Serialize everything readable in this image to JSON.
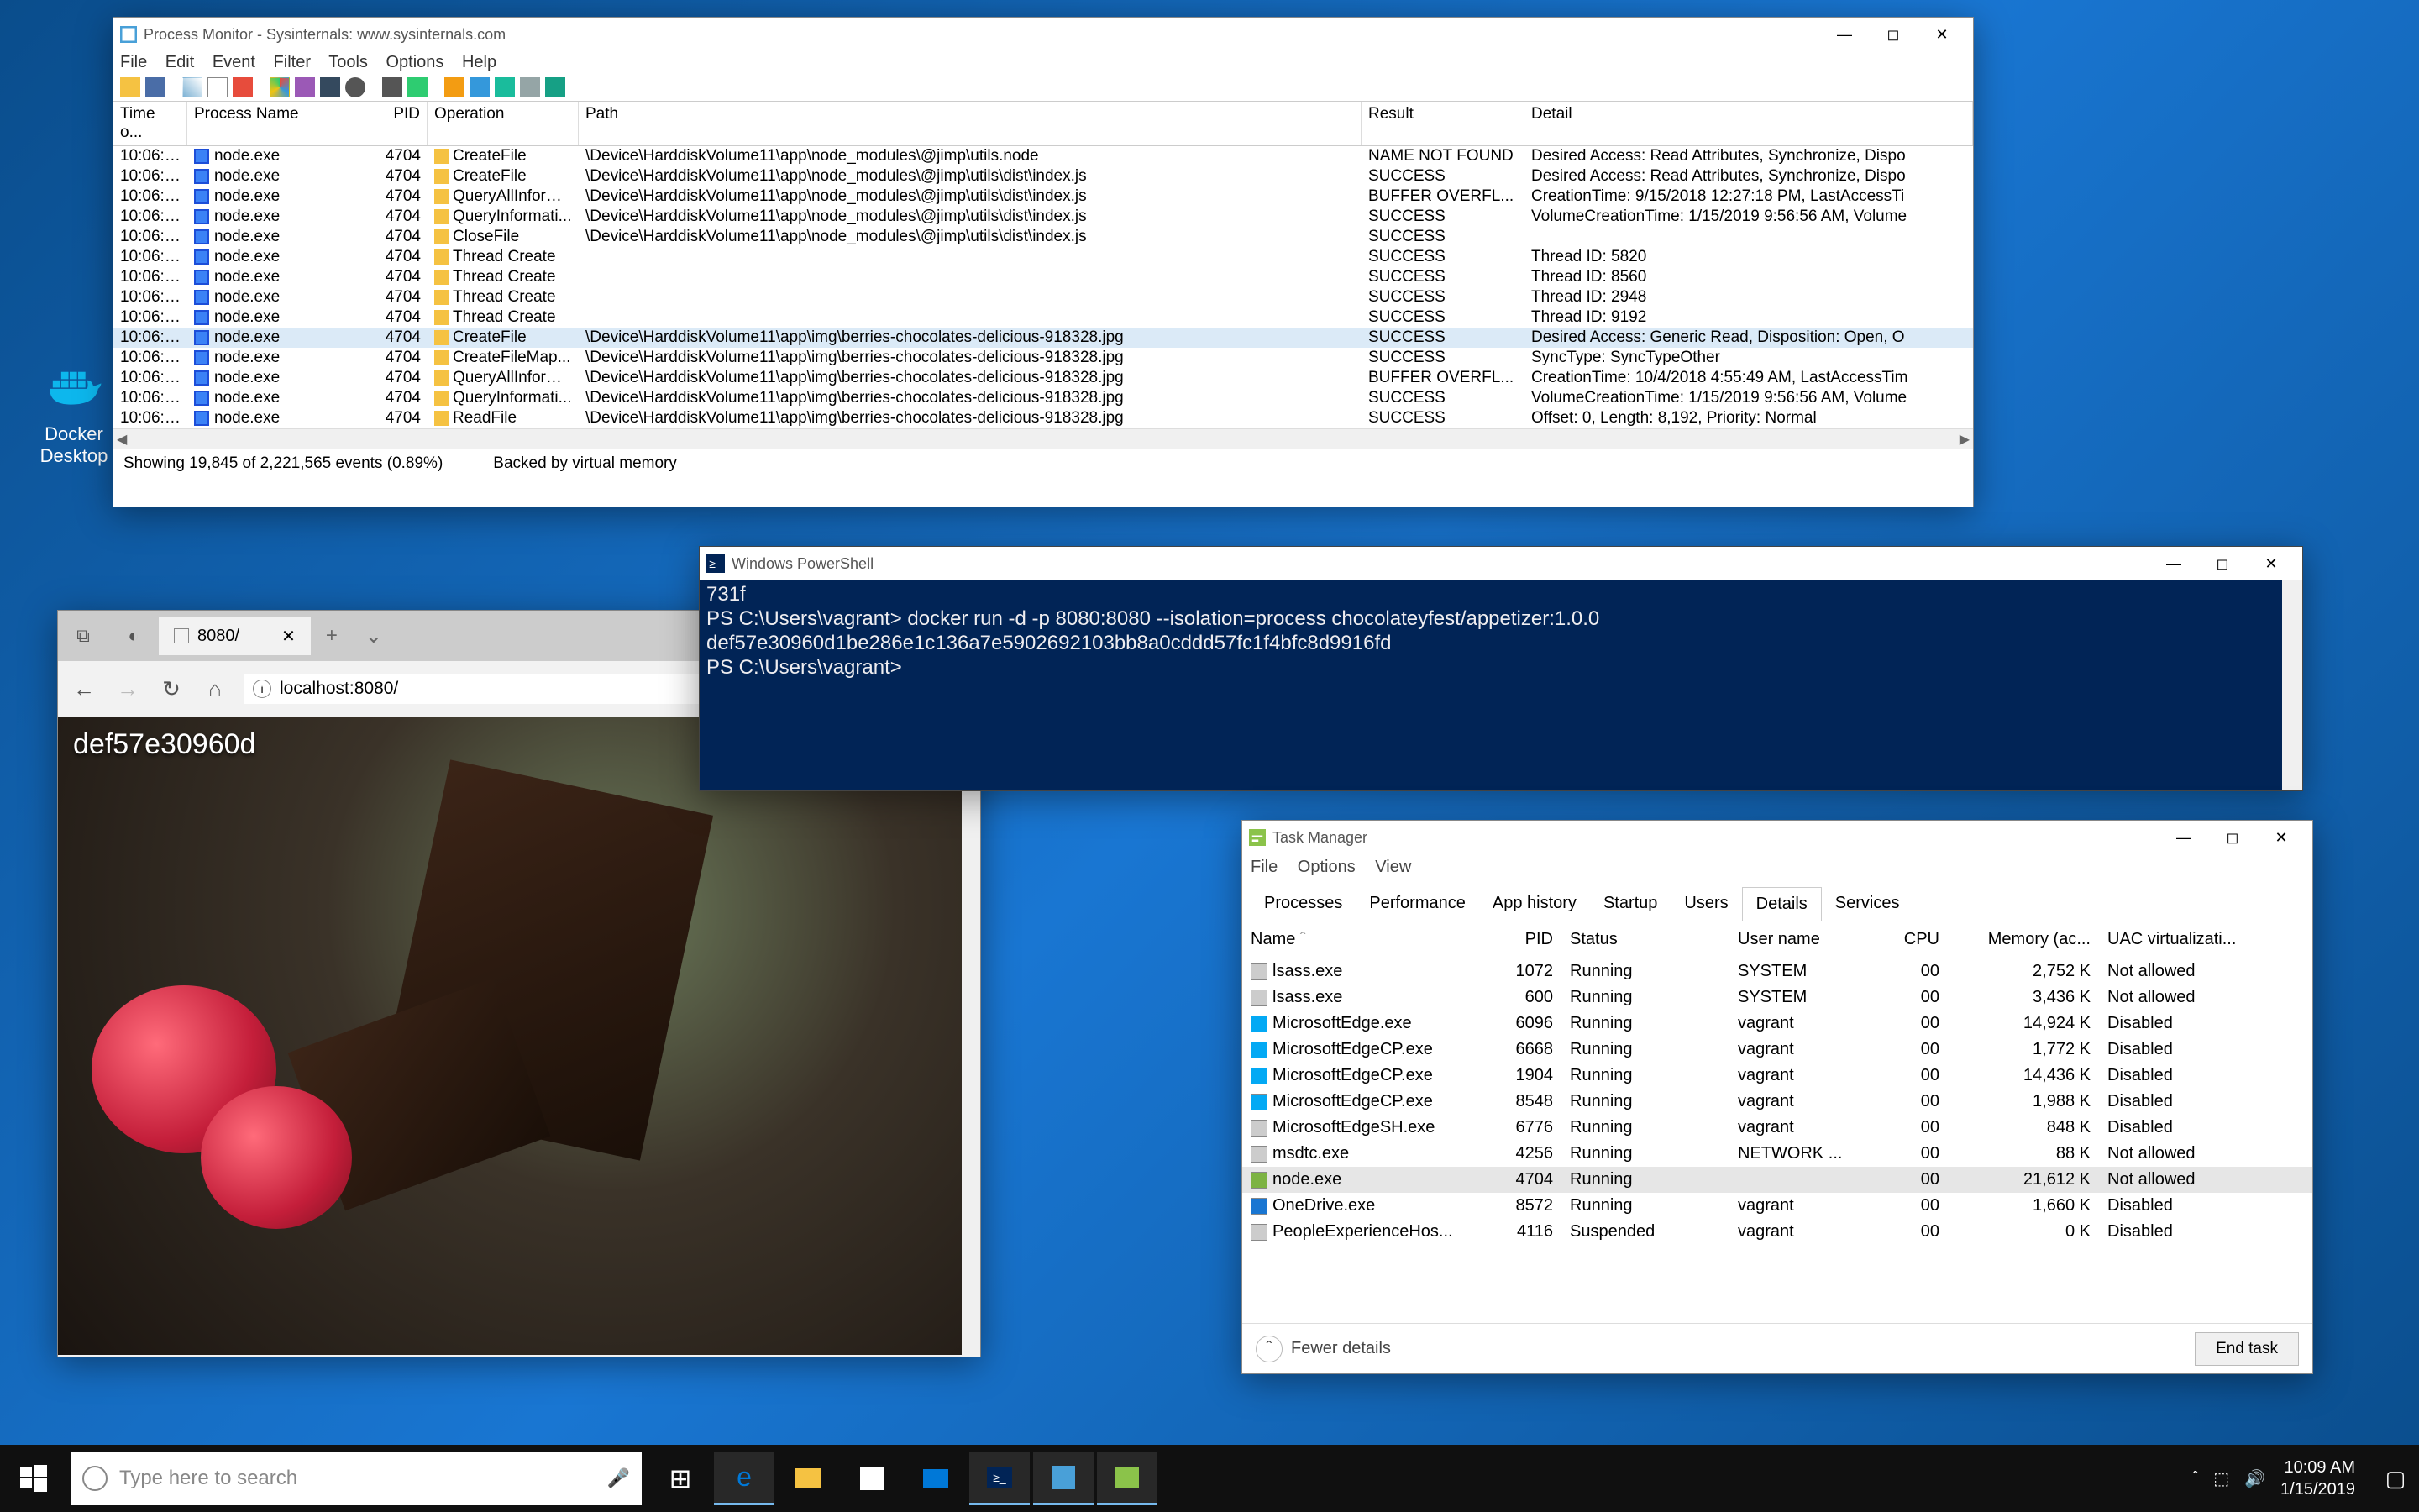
{
  "desktop": {
    "docker_label": "Docker\nDesktop"
  },
  "procmon": {
    "title": "Process Monitor - Sysinternals: www.sysinternals.com",
    "menu": [
      "File",
      "Edit",
      "Event",
      "Filter",
      "Tools",
      "Options",
      "Help"
    ],
    "columns": [
      "Time o...",
      "Process Name",
      "PID",
      "Operation",
      "Path",
      "Result",
      "Detail"
    ],
    "rows": [
      {
        "t": "10:06:1...",
        "p": "node.exe",
        "pid": "4704",
        "op": "CreateFile",
        "path": "\\Device\\HarddiskVolume11\\app\\node_modules\\@jimp\\utils.node",
        "r": "NAME NOT FOUND",
        "d": "Desired Access: Read Attributes, Synchronize, Dispo"
      },
      {
        "t": "10:06:1...",
        "p": "node.exe",
        "pid": "4704",
        "op": "CreateFile",
        "path": "\\Device\\HarddiskVolume11\\app\\node_modules\\@jimp\\utils\\dist\\index.js",
        "r": "SUCCESS",
        "d": "Desired Access: Read Attributes, Synchronize, Dispo"
      },
      {
        "t": "10:06:1...",
        "p": "node.exe",
        "pid": "4704",
        "op": "QueryAllInform...",
        "path": "\\Device\\HarddiskVolume11\\app\\node_modules\\@jimp\\utils\\dist\\index.js",
        "r": "BUFFER OVERFL...",
        "d": "CreationTime: 9/15/2018 12:27:18 PM, LastAccessTi"
      },
      {
        "t": "10:06:1...",
        "p": "node.exe",
        "pid": "4704",
        "op": "QueryInformati...",
        "path": "\\Device\\HarddiskVolume11\\app\\node_modules\\@jimp\\utils\\dist\\index.js",
        "r": "SUCCESS",
        "d": "VolumeCreationTime: 1/15/2019 9:56:56 AM, Volume"
      },
      {
        "t": "10:06:1...",
        "p": "node.exe",
        "pid": "4704",
        "op": "CloseFile",
        "path": "\\Device\\HarddiskVolume11\\app\\node_modules\\@jimp\\utils\\dist\\index.js",
        "r": "SUCCESS",
        "d": ""
      },
      {
        "t": "10:06:1...",
        "p": "node.exe",
        "pid": "4704",
        "op": "Thread Create",
        "path": "",
        "r": "SUCCESS",
        "d": "Thread ID: 5820"
      },
      {
        "t": "10:06:1...",
        "p": "node.exe",
        "pid": "4704",
        "op": "Thread Create",
        "path": "",
        "r": "SUCCESS",
        "d": "Thread ID: 8560"
      },
      {
        "t": "10:06:1...",
        "p": "node.exe",
        "pid": "4704",
        "op": "Thread Create",
        "path": "",
        "r": "SUCCESS",
        "d": "Thread ID: 2948"
      },
      {
        "t": "10:06:1...",
        "p": "node.exe",
        "pid": "4704",
        "op": "Thread Create",
        "path": "",
        "r": "SUCCESS",
        "d": "Thread ID: 9192"
      },
      {
        "t": "10:06:1...",
        "p": "node.exe",
        "pid": "4704",
        "op": "CreateFile",
        "path": "\\Device\\HarddiskVolume11\\app\\img\\berries-chocolates-delicious-918328.jpg",
        "r": "SUCCESS",
        "d": "Desired Access: Generic Read, Disposition: Open, O",
        "sel": true
      },
      {
        "t": "10:06:1...",
        "p": "node.exe",
        "pid": "4704",
        "op": "CreateFileMap...",
        "path": "\\Device\\HarddiskVolume11\\app\\img\\berries-chocolates-delicious-918328.jpg",
        "r": "SUCCESS",
        "d": "SyncType: SyncTypeOther"
      },
      {
        "t": "10:06:1...",
        "p": "node.exe",
        "pid": "4704",
        "op": "QueryAllInform...",
        "path": "\\Device\\HarddiskVolume11\\app\\img\\berries-chocolates-delicious-918328.jpg",
        "r": "BUFFER OVERFL...",
        "d": "CreationTime: 10/4/2018 4:55:49 AM, LastAccessTim"
      },
      {
        "t": "10:06:1...",
        "p": "node.exe",
        "pid": "4704",
        "op": "QueryInformati...",
        "path": "\\Device\\HarddiskVolume11\\app\\img\\berries-chocolates-delicious-918328.jpg",
        "r": "SUCCESS",
        "d": "VolumeCreationTime: 1/15/2019 9:56:56 AM, Volume"
      },
      {
        "t": "10:06:1...",
        "p": "node.exe",
        "pid": "4704",
        "op": "ReadFile",
        "path": "\\Device\\HarddiskVolume11\\app\\img\\berries-chocolates-delicious-918328.jpg",
        "r": "SUCCESS",
        "d": "Offset: 0, Length: 8,192, Priority: Normal"
      }
    ],
    "status_events": "Showing 19,845 of 2,221,565 events (0.89%)",
    "status_mem": "Backed by virtual memory"
  },
  "powershell": {
    "title": "Windows PowerShell",
    "lines": [
      "731f",
      "PS C:\\Users\\vagrant> docker run -d -p 8080:8080 --isolation=process chocolateyfest/appetizer:1.0.0",
      "def57e30960d1be286e1c136a7e5902692103bb8a0cddd57fc1f4bfc8d9916fd",
      "PS C:\\Users\\vagrant>"
    ]
  },
  "edge": {
    "tab_title": "8080/",
    "address": "localhost:8080/",
    "overlay": "def57e30960d"
  },
  "taskmgr": {
    "title": "Task Manager",
    "menu": [
      "File",
      "Options",
      "View"
    ],
    "tabs": [
      "Processes",
      "Performance",
      "App history",
      "Startup",
      "Users",
      "Details",
      "Services"
    ],
    "active_tab": 5,
    "columns": [
      "Name",
      "PID",
      "Status",
      "User name",
      "CPU",
      "Memory (ac...",
      "UAC virtualizati..."
    ],
    "rows": [
      {
        "name": "lsass.exe",
        "pid": "1072",
        "status": "Running",
        "user": "SYSTEM",
        "cpu": "00",
        "mem": "2,752 K",
        "uac": "Not allowed",
        "ico": "gray"
      },
      {
        "name": "lsass.exe",
        "pid": "600",
        "status": "Running",
        "user": "SYSTEM",
        "cpu": "00",
        "mem": "3,436 K",
        "uac": "Not allowed",
        "ico": "gray"
      },
      {
        "name": "MicrosoftEdge.exe",
        "pid": "6096",
        "status": "Running",
        "user": "vagrant",
        "cpu": "00",
        "mem": "14,924 K",
        "uac": "Disabled",
        "ico": "blue"
      },
      {
        "name": "MicrosoftEdgeCP.exe",
        "pid": "6668",
        "status": "Running",
        "user": "vagrant",
        "cpu": "00",
        "mem": "1,772 K",
        "uac": "Disabled",
        "ico": "blue"
      },
      {
        "name": "MicrosoftEdgeCP.exe",
        "pid": "1904",
        "status": "Running",
        "user": "vagrant",
        "cpu": "00",
        "mem": "14,436 K",
        "uac": "Disabled",
        "ico": "blue"
      },
      {
        "name": "MicrosoftEdgeCP.exe",
        "pid": "8548",
        "status": "Running",
        "user": "vagrant",
        "cpu": "00",
        "mem": "1,988 K",
        "uac": "Disabled",
        "ico": "blue"
      },
      {
        "name": "MicrosoftEdgeSH.exe",
        "pid": "6776",
        "status": "Running",
        "user": "vagrant",
        "cpu": "00",
        "mem": "848 K",
        "uac": "Disabled",
        "ico": "gray"
      },
      {
        "name": "msdtc.exe",
        "pid": "4256",
        "status": "Running",
        "user": "NETWORK ...",
        "cpu": "00",
        "mem": "88 K",
        "uac": "Not allowed",
        "ico": "gray"
      },
      {
        "name": "node.exe",
        "pid": "4704",
        "status": "Running",
        "user": "",
        "cpu": "00",
        "mem": "21,612 K",
        "uac": "Not allowed",
        "ico": "green",
        "sel": true
      },
      {
        "name": "OneDrive.exe",
        "pid": "8572",
        "status": "Running",
        "user": "vagrant",
        "cpu": "00",
        "mem": "1,660 K",
        "uac": "Disabled",
        "ico": "cloud"
      },
      {
        "name": "PeopleExperienceHos...",
        "pid": "4116",
        "status": "Suspended",
        "user": "vagrant",
        "cpu": "00",
        "mem": "0 K",
        "uac": "Disabled",
        "ico": "gray"
      }
    ],
    "fewer": "Fewer details",
    "end_task": "End task"
  },
  "taskbar": {
    "search_placeholder": "Type here to search",
    "time": "10:09 AM",
    "date": "1/15/2019"
  }
}
